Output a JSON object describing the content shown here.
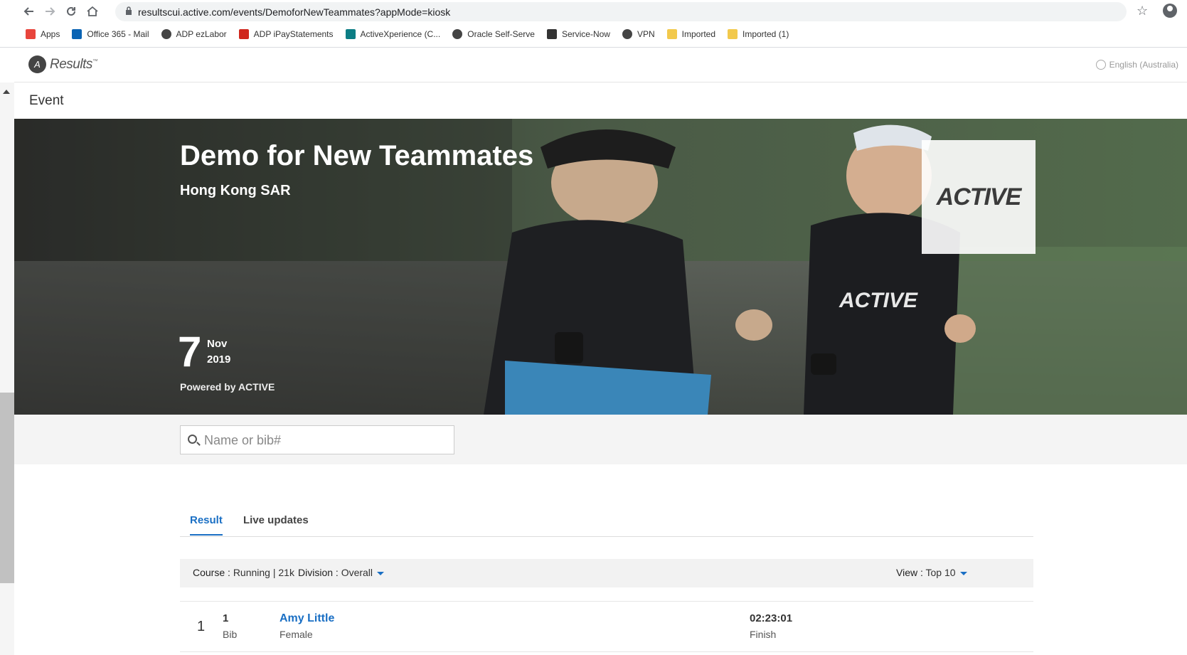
{
  "browser": {
    "url": "resultscui.active.com/events/DemoforNewTeammates?appMode=kiosk",
    "bookmarks": [
      {
        "label": "Apps",
        "icon": "apps-grid-icon",
        "color": "#e8453c"
      },
      {
        "label": "Office 365 - Mail",
        "icon": "outlook-icon",
        "color": "#0a64b4"
      },
      {
        "label": "ADP ezLabor",
        "icon": "globe-icon",
        "color": "#444444"
      },
      {
        "label": "ADP iPayStatements",
        "icon": "adp-icon",
        "color": "#d0271d"
      },
      {
        "label": "ActiveXperience (C...",
        "icon": "sharepoint-icon",
        "color": "#0b7d84"
      },
      {
        "label": "Oracle Self-Serve",
        "icon": "globe-icon",
        "color": "#444444"
      },
      {
        "label": "Service-Now",
        "icon": "servicenow-icon",
        "color": "#333333"
      },
      {
        "label": "VPN",
        "icon": "globe-icon",
        "color": "#444444"
      },
      {
        "label": "Imported",
        "icon": "folder-icon",
        "color": "#f2c94c"
      },
      {
        "label": "Imported (1)",
        "icon": "folder-icon",
        "color": "#f2c94c"
      }
    ]
  },
  "header": {
    "logo_text": "Results",
    "language": "English (Australia)"
  },
  "event_bar": {
    "title": "Event"
  },
  "hero": {
    "title": "Demo for New Teammates",
    "location": "Hong Kong SAR",
    "day": "7",
    "month": "Nov",
    "year": "2019",
    "powered_by": "Powered by ACTIVE",
    "sponsor_logo": "ACTIVE"
  },
  "search": {
    "placeholder": "Name or bib#"
  },
  "tabs": [
    {
      "label": "Result",
      "active": true
    },
    {
      "label": "Live updates",
      "active": false
    }
  ],
  "filters": {
    "course_label": "Course : ",
    "course_value": "Running | 21k",
    "division_label": "Division : ",
    "division_value": "Overall",
    "view_label": "View : ",
    "view_value": "Top 10"
  },
  "results": [
    {
      "rank": "1",
      "bib": "1",
      "bib_label": "Bib",
      "name": "Amy Little",
      "gender": "Female",
      "time": "02:23:01",
      "time_label": "Finish"
    }
  ],
  "colors": {
    "accent": "#1a6fc4"
  }
}
